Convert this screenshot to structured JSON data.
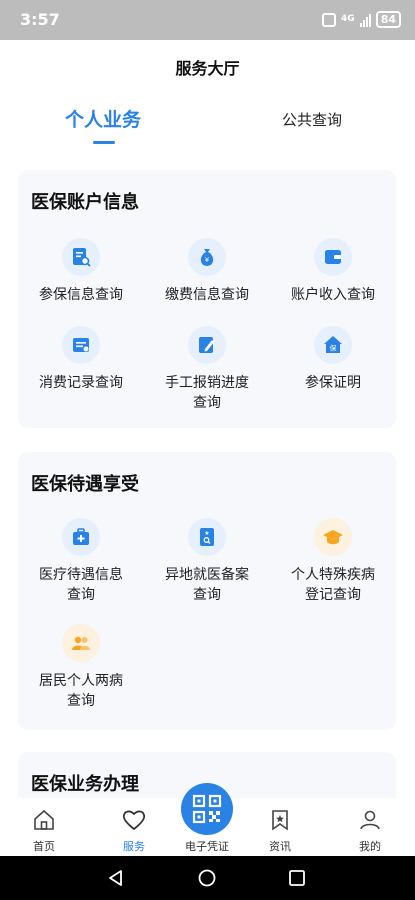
{
  "status": {
    "time": "3:57",
    "network": "4G",
    "battery": "84"
  },
  "header": {
    "title": "服务大厅"
  },
  "tabs": [
    {
      "label": "个人业务",
      "active": true
    },
    {
      "label": "公共查询",
      "active": false
    }
  ],
  "sections": [
    {
      "title": "医保账户信息",
      "items": [
        {
          "label": "参保信息查询",
          "icon": "doc-search-icon"
        },
        {
          "label": "缴费信息查询",
          "icon": "money-bag-icon"
        },
        {
          "label": "账户收入查询",
          "icon": "wallet-icon"
        },
        {
          "label": "消费记录查询",
          "icon": "receipt-icon"
        },
        {
          "label": "手工报销进度查询",
          "line1": "手工报销进度",
          "line2": "查询",
          "icon": "edit-doc-icon"
        },
        {
          "label": "参保证明",
          "icon": "insurance-house-icon"
        }
      ]
    },
    {
      "title": "医保待遇享受",
      "items": [
        {
          "line1": "医疗待遇信息",
          "line2": "查询",
          "icon": "medical-kit-icon"
        },
        {
          "line1": "异地就医备案",
          "line2": "查询",
          "icon": "id-card-icon"
        },
        {
          "line1": "个人特殊疾病",
          "line2": "登记查询",
          "icon": "graduation-cap-icon"
        },
        {
          "line1": "居民个人两病",
          "line2": "查询",
          "icon": "people-icon"
        }
      ]
    },
    {
      "title": "医保业务办理"
    }
  ],
  "bottom_nav": {
    "home": "首页",
    "service": "服务",
    "voucher": "电子凭证",
    "news": "资讯",
    "mine": "我的"
  },
  "colors": {
    "accent": "#2a82e4",
    "icon_bg": "#e6f0fc",
    "orange": "#f5a623"
  }
}
